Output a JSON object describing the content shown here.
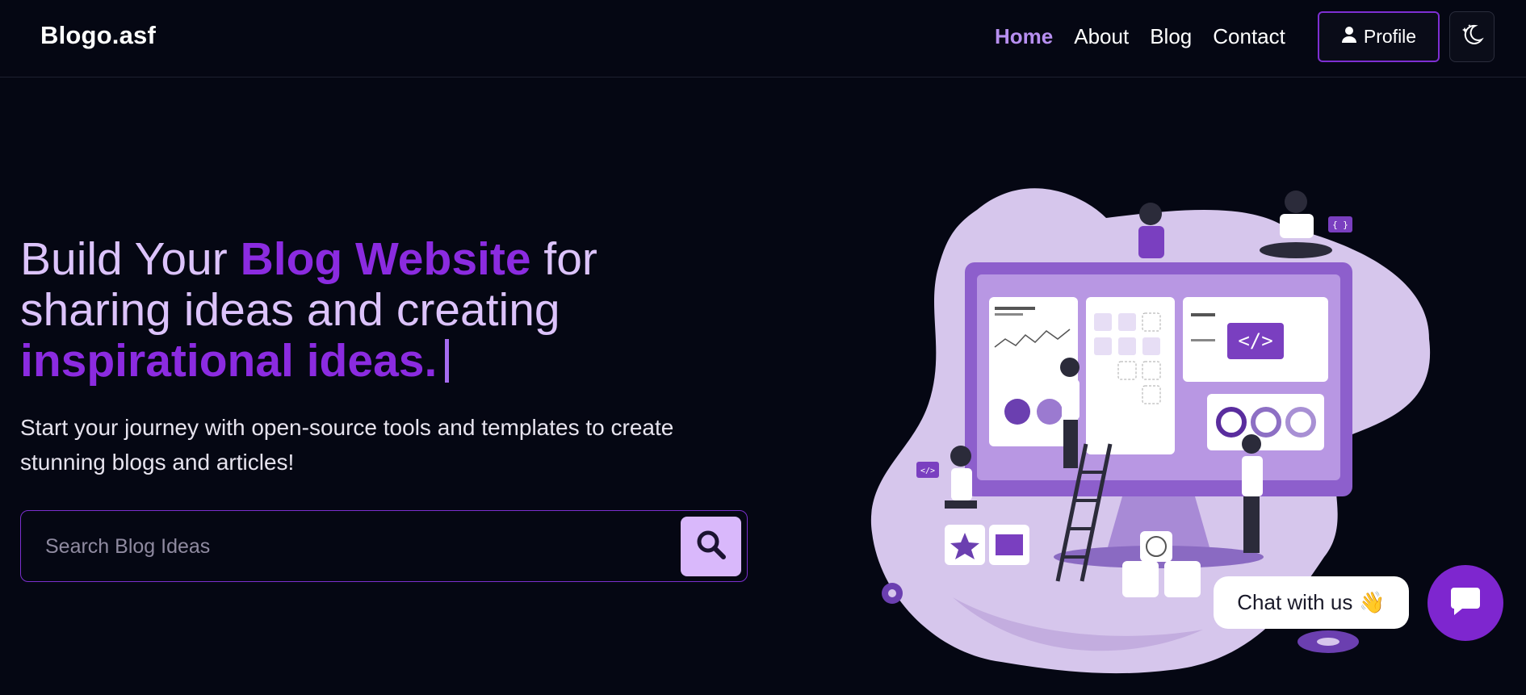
{
  "brand": {
    "name": "Blogo.asf"
  },
  "nav": {
    "items": [
      {
        "label": "Home",
        "active": true
      },
      {
        "label": "About",
        "active": false
      },
      {
        "label": "Blog",
        "active": false
      },
      {
        "label": "Contact",
        "active": false
      }
    ],
    "profile_label": "Profile",
    "profile_icon": "user-icon",
    "theme_icon": "moon-stars-icon"
  },
  "hero": {
    "headline": {
      "part1": "Build Your ",
      "highlight1": "Blog Website",
      "part2": " for sharing ideas and creating ",
      "highlight2": "inspirational ideas."
    },
    "subtext": "Start your journey with open-source tools and templates to create stunning blogs and articles!",
    "search": {
      "placeholder": "Search Blog Ideas",
      "value": "",
      "icon": "search-icon"
    }
  },
  "chat": {
    "label": "Chat with us",
    "emoji": "👋",
    "icon": "chat-bubble-icon"
  },
  "colors": {
    "background": "#050713",
    "accent": "#8b2be0",
    "accent_light": "#dcc3fb",
    "search_button": "#d9b8fb",
    "chat_fab": "#7e26cf"
  }
}
